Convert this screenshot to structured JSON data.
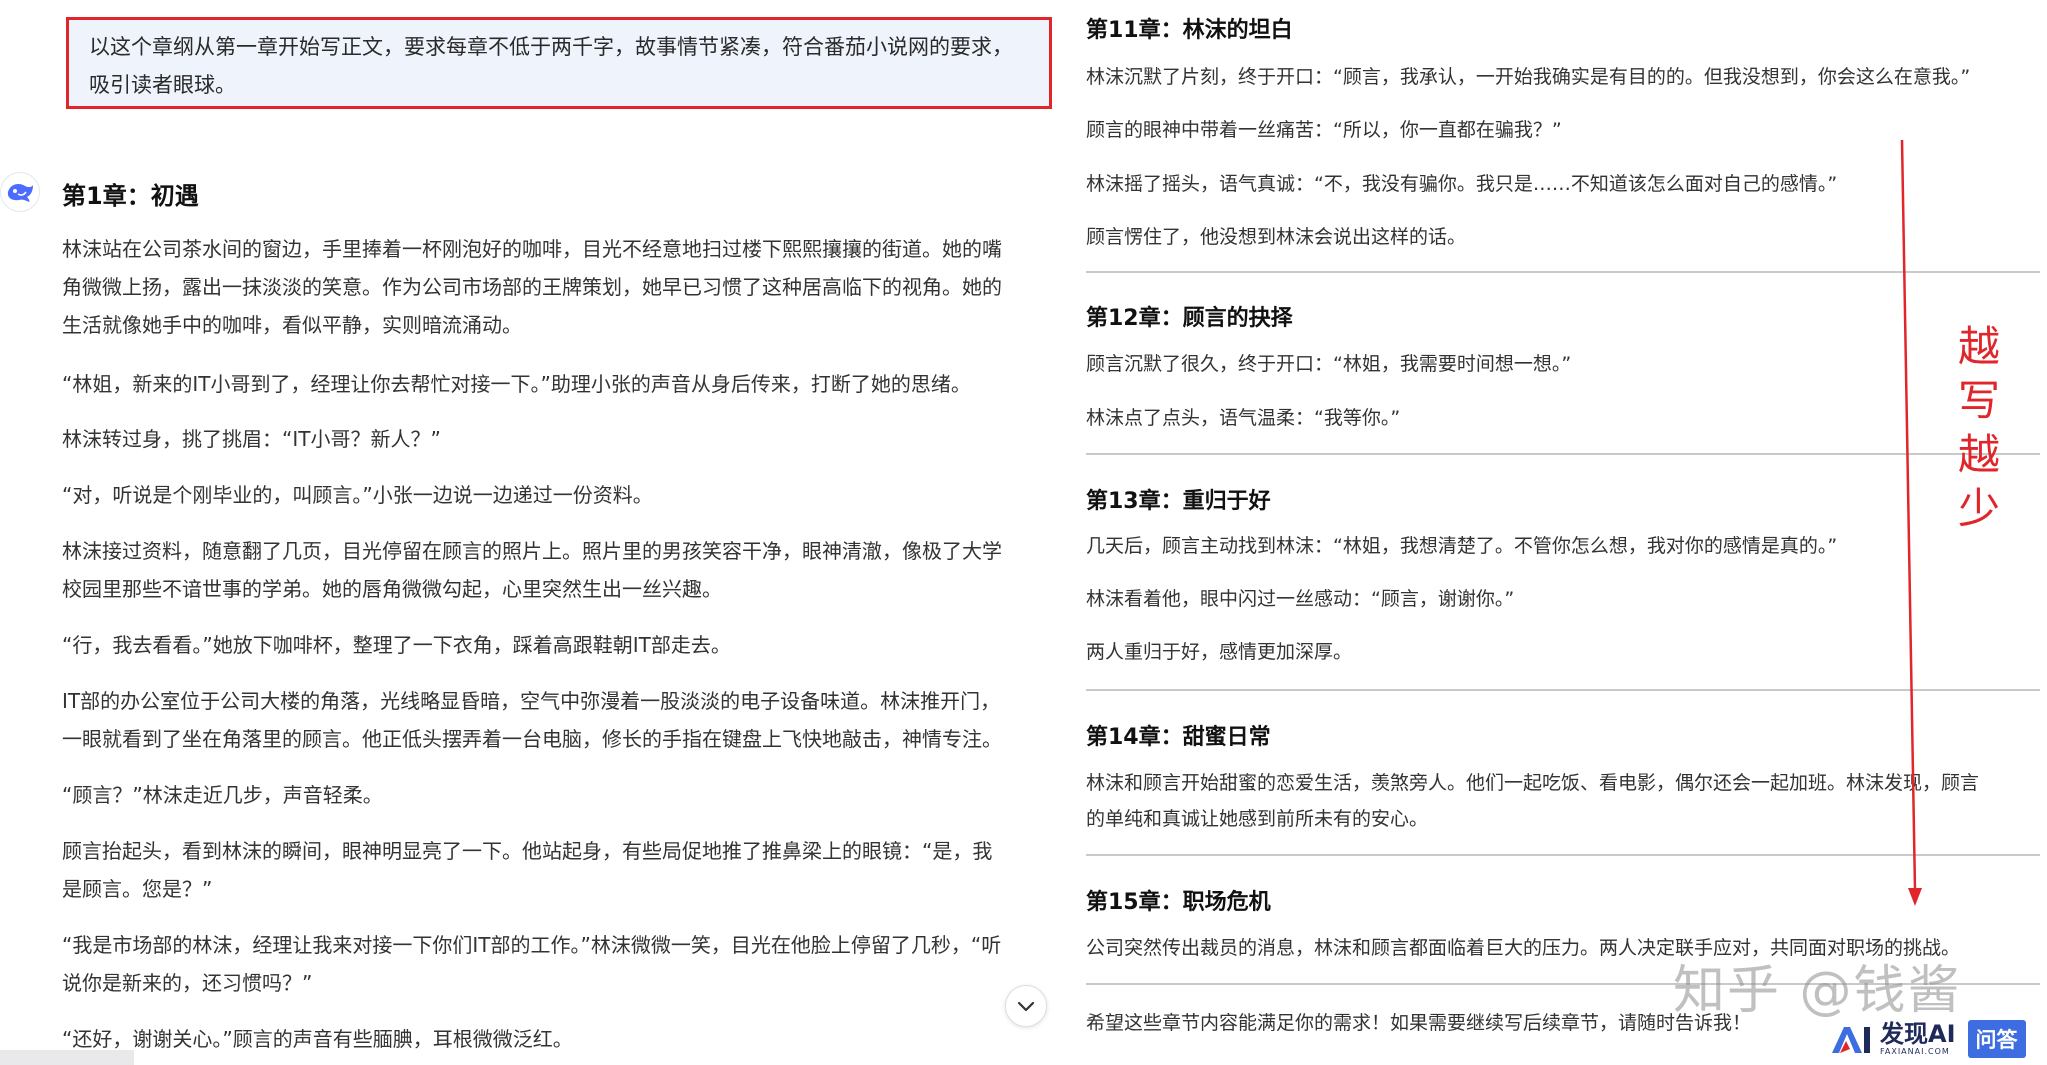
{
  "prompt": {
    "line1": "以这个章纲从第一章开始写正文，要求每章不低于两千字，故事情节紧凑，符合番茄小说网的要求，",
    "line2": "吸引读者眼球。"
  },
  "chapter1": {
    "title": "第1章：初遇",
    "paragraphs": [
      [
        "林沫站在公司茶水间的窗边，手里捧着一杯刚泡好的咖啡，目光不经意地扫过楼下熙熙攘攘的街道。她的嘴",
        "角微微上扬，露出一抹淡淡的笑意。作为公司市场部的王牌策划，她早已习惯了这种居高临下的视角。她的",
        "生活就像她手中的咖啡，看似平静，实则暗流涌动。"
      ],
      [
        "“林姐，新来的IT小哥到了，经理让你去帮忙对接一下。”助理小张的声音从身后传来，打断了她的思绪。"
      ],
      [
        "林沫转过身，挑了挑眉：“IT小哥？新人？”"
      ],
      [
        "“对，听说是个刚毕业的，叫顾言。”小张一边说一边递过一份资料。"
      ],
      [
        "林沫接过资料，随意翻了几页，目光停留在顾言的照片上。照片里的男孩笑容干净，眼神清澈，像极了大学",
        "校园里那些不谙世事的学弟。她的唇角微微勾起，心里突然生出一丝兴趣。"
      ],
      [
        "“行，我去看看。”她放下咖啡杯，整理了一下衣角，踩着高跟鞋朝IT部走去。"
      ],
      [
        "IT部的办公室位于公司大楼的角落，光线略显昏暗，空气中弥漫着一股淡淡的电子设备味道。林沫推开门，",
        "一眼就看到了坐在角落里的顾言。他正低头摆弄着一台电脑，修长的手指在键盘上飞快地敲击，神情专注。"
      ],
      [
        "“顾言？”林沫走近几步，声音轻柔。"
      ],
      [
        "顾言抬起头，看到林沫的瞬间，眼神明显亮了一下。他站起身，有些局促地推了推鼻梁上的眼镜：“是，我",
        "是顾言。您是？”"
      ],
      [
        "“我是市场部的林沫，经理让我来对接一下你们IT部的工作。”林沫微微一笑，目光在他脸上停留了几秒，“听",
        "说你是新来的，还习惯吗？”"
      ],
      [
        "“还好，谢谢关心。”顾言的声音有些腼腆，耳根微微泛红。"
      ]
    ]
  },
  "chapters": [
    {
      "title": "第11章：林沫的坦白",
      "lines": [
        "林沫沉默了片刻，终于开口：“顾言，我承认，一开始我确实是有目的的。但我没想到，你会这么在意我。”",
        "顾言的眼神中带着一丝痛苦：“所以，你一直都在骗我？”",
        "林沫摇了摇头，语气真诚：“不，我没有骗你。我只是……不知道该怎么面对自己的感情。”",
        "顾言愣住了，他没想到林沫会说出这样的话。"
      ]
    },
    {
      "title": "第12章：顾言的抉择",
      "lines": [
        "顾言沉默了很久，终于开口：“林姐，我需要时间想一想。”",
        "林沫点了点头，语气温柔：“我等你。”"
      ]
    },
    {
      "title": "第13章：重归于好",
      "lines": [
        "几天后，顾言主动找到林沫：“林姐，我想清楚了。不管你怎么想，我对你的感情是真的。”",
        "林沫看着他，眼中闪过一丝感动：“顾言，谢谢你。”",
        "两人重归于好，感情更加深厚。"
      ]
    },
    {
      "title": "第14章：甜蜜日常",
      "lines": [
        "林沫和顾言开始甜蜜的恋爱生活，羡煞旁人。他们一起吃饭、看电影，偶尔还会一起加班。林沫发现，顾言",
        "的单纯和真诚让她感到前所未有的安心。"
      ]
    },
    {
      "title": "第15章：职场危机",
      "lines": [
        "公司突然传出裁员的消息，林沫和顾言都面临着巨大的压力。两人决定联手应对，共同面对职场的挑战。"
      ]
    }
  ],
  "closing": "希望这些章节内容能满足你的需求！如果需要继续写后续章节，请随时告诉我！",
  "annotation": [
    "越",
    "写",
    "越",
    "少"
  ],
  "watermark": "知乎 @钱酱",
  "brand": {
    "name": "发现AI",
    "sub": "FAXIANAI.COM",
    "badge": "问答"
  },
  "colors": {
    "highlight_border": "#e0262b",
    "prompt_bg": "#eef3fc",
    "annotation": "#e0262b",
    "brand_blue": "#3d6de0"
  },
  "icons": [
    "bot-avatar-icon",
    "chevron-down-icon",
    "red-arrow-icon",
    "brand-logo-icon"
  ]
}
